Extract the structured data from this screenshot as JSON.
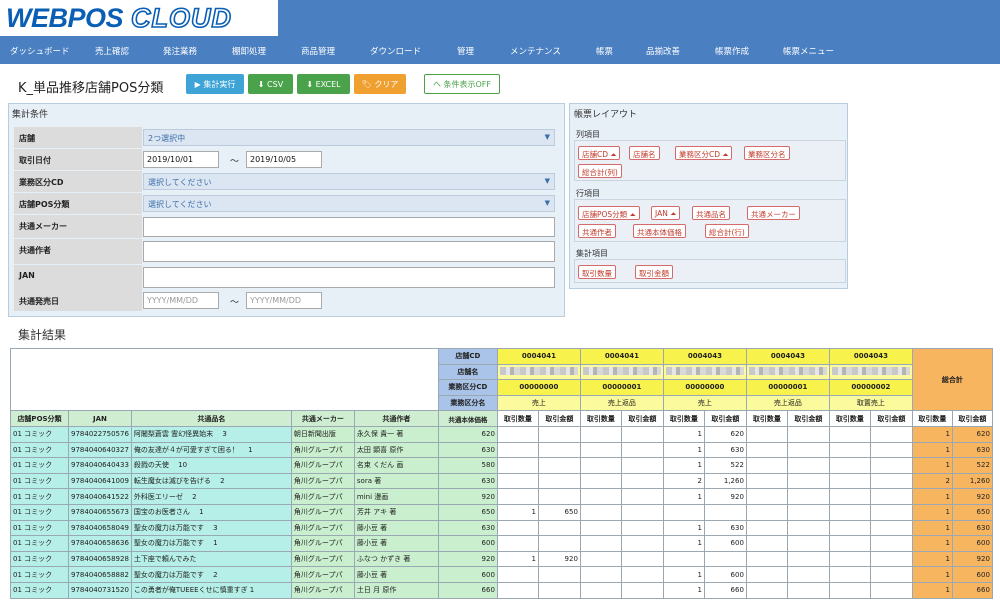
{
  "logo": {
    "part1": "WEBPOS",
    "part2": "CLOUD"
  },
  "nav": [
    "ダッシュボード",
    "売上確認",
    "発注業務",
    "棚卸処理",
    "商品管理",
    "ダウンロード",
    "管理",
    "メンテナンス",
    "帳票",
    "品揃改善",
    "帳票作成",
    "帳票メニュー"
  ],
  "page_title": "K_単品推移店舗POS分類",
  "buttons": {
    "run": "▶ 集計実行",
    "csv": "⬇ CSV",
    "excel": "⬇ EXCEL",
    "clear": "🏷 クリア",
    "toggle": "ヘ 条件表示OFF"
  },
  "conditions": {
    "title": "集計条件",
    "store": {
      "label": "店舗",
      "value": "2つ選択中"
    },
    "date": {
      "label": "取引日付",
      "from": "2019/10/01",
      "to": "2019/10/05",
      "sep": "～"
    },
    "biz": {
      "label": "業務区分CD",
      "value": "選択してください"
    },
    "pos": {
      "label": "店舗POS分類",
      "value": "選択してください"
    },
    "maker": {
      "label": "共通メーカー"
    },
    "author": {
      "label": "共通作者"
    },
    "jan": {
      "label": "JAN"
    },
    "release": {
      "label": "共通発売日",
      "from_ph": "YYYY/MM/DD",
      "to_ph": "YYYY/MM/DD",
      "sep": "～"
    }
  },
  "layout": {
    "title": "帳票レイアウト",
    "cols_label": "列項目",
    "cols": [
      "店舗CD ⏶",
      "店舗名",
      "業務区分CD ⏶",
      "業務区分名",
      "総合計(列)"
    ],
    "rows_label": "行項目",
    "rows": [
      "店舗POS分類 ⏶",
      "JAN ⏶",
      "共通品名",
      "共通メーカー",
      "共通作者",
      "共通本体価格",
      "総合計(行)"
    ],
    "agg_label": "集計項目",
    "aggs": [
      "取引数量",
      "取引金額"
    ]
  },
  "result_title": "集計結果",
  "table": {
    "lbl_storecd": "店舗CD",
    "lbl_storename": "店舗名",
    "lbl_bizcd": "業務区分CD",
    "lbl_bizname": "業務区分名",
    "storecd": [
      "0004041",
      "0004041",
      "0004043",
      "0004043",
      "0004043"
    ],
    "bizcd": [
      "00000000",
      "00000001",
      "00000000",
      "00000001",
      "00000002"
    ],
    "bizname": [
      "売上",
      "売上返品",
      "売上",
      "売上返品",
      "取置売上"
    ],
    "total": "総合計",
    "row_headers": [
      "店舗POS分類",
      "JAN",
      "共通品名",
      "共通メーカー",
      "共通作者",
      "共通本体価格"
    ],
    "qty": "取引数量",
    "amt": "取引金額",
    "rows": [
      [
        "01 コミック",
        "9784022750576",
        "阿闍梨蒼雲 霊幻怪異始末　 3",
        "朝日新聞出版",
        "永久保 貴一 著",
        "620",
        "",
        "",
        "",
        "",
        "1",
        "620",
        "",
        "",
        "",
        "",
        "1",
        "620"
      ],
      [
        "01 コミック",
        "9784040640327",
        "俺の友達が４が可愛すぎて困る！　 1",
        "角川グループパ",
        "太田 顕喜 原作",
        "630",
        "",
        "",
        "",
        "",
        "1",
        "630",
        "",
        "",
        "",
        "",
        "1",
        "630"
      ],
      [
        "01 コミック",
        "9784040640433",
        "殺戮の天使　 10",
        "角川グループパ",
        "名束 くだん 画",
        "580",
        "",
        "",
        "",
        "",
        "1",
        "522",
        "",
        "",
        "",
        "",
        "1",
        "522"
      ],
      [
        "01 コミック",
        "9784040641009",
        "転生魔女は滅びを告げる　 2",
        "角川グループパ",
        "sora 著",
        "630",
        "",
        "",
        "",
        "",
        "2",
        "1,260",
        "",
        "",
        "",
        "",
        "2",
        "1,260"
      ],
      [
        "01 コミック",
        "9784040641522",
        "外科医エリーゼ　 2",
        "角川グループパ",
        "mini 漫画",
        "920",
        "",
        "",
        "",
        "",
        "1",
        "920",
        "",
        "",
        "",
        "",
        "1",
        "920"
      ],
      [
        "01 コミック",
        "9784040655673",
        "国宝のお医者さん　 1",
        "角川グループパ",
        "芳井 アキ 著",
        "650",
        "1",
        "650",
        "",
        "",
        "",
        "",
        "",
        "",
        "",
        "",
        "1",
        "650"
      ],
      [
        "01 コミック",
        "9784040658049",
        "聖女の魔力は万能です　 3",
        "角川グループパ",
        "藤小豆 著",
        "630",
        "",
        "",
        "",
        "",
        "1",
        "630",
        "",
        "",
        "",
        "",
        "1",
        "630"
      ],
      [
        "01 コミック",
        "9784040658636",
        "聖女の魔力は万能です　 1",
        "角川グループパ",
        "藤小豆 著",
        "600",
        "",
        "",
        "",
        "",
        "1",
        "600",
        "",
        "",
        "",
        "",
        "1",
        "600"
      ],
      [
        "01 コミック",
        "9784040658928",
        "土下座で頼んでみた",
        "角川グループパ",
        "ふなつ かずき 著",
        "920",
        "1",
        "920",
        "",
        "",
        "",
        "",
        "",
        "",
        "",
        "",
        "1",
        "920"
      ],
      [
        "01 コミック",
        "9784040658882",
        "聖女の魔力は万能です　 2",
        "角川グループパ",
        "藤小豆 著",
        "600",
        "",
        "",
        "",
        "",
        "1",
        "600",
        "",
        "",
        "",
        "",
        "1",
        "600"
      ],
      [
        "01 コミック",
        "9784040731520",
        "この勇者が俺TUEEEくせに慎重すぎ 1",
        "角川グループパ",
        "土日 月 原作",
        "660",
        "",
        "",
        "",
        "",
        "1",
        "660",
        "",
        "",
        "",
        "",
        "1",
        "660"
      ]
    ]
  }
}
